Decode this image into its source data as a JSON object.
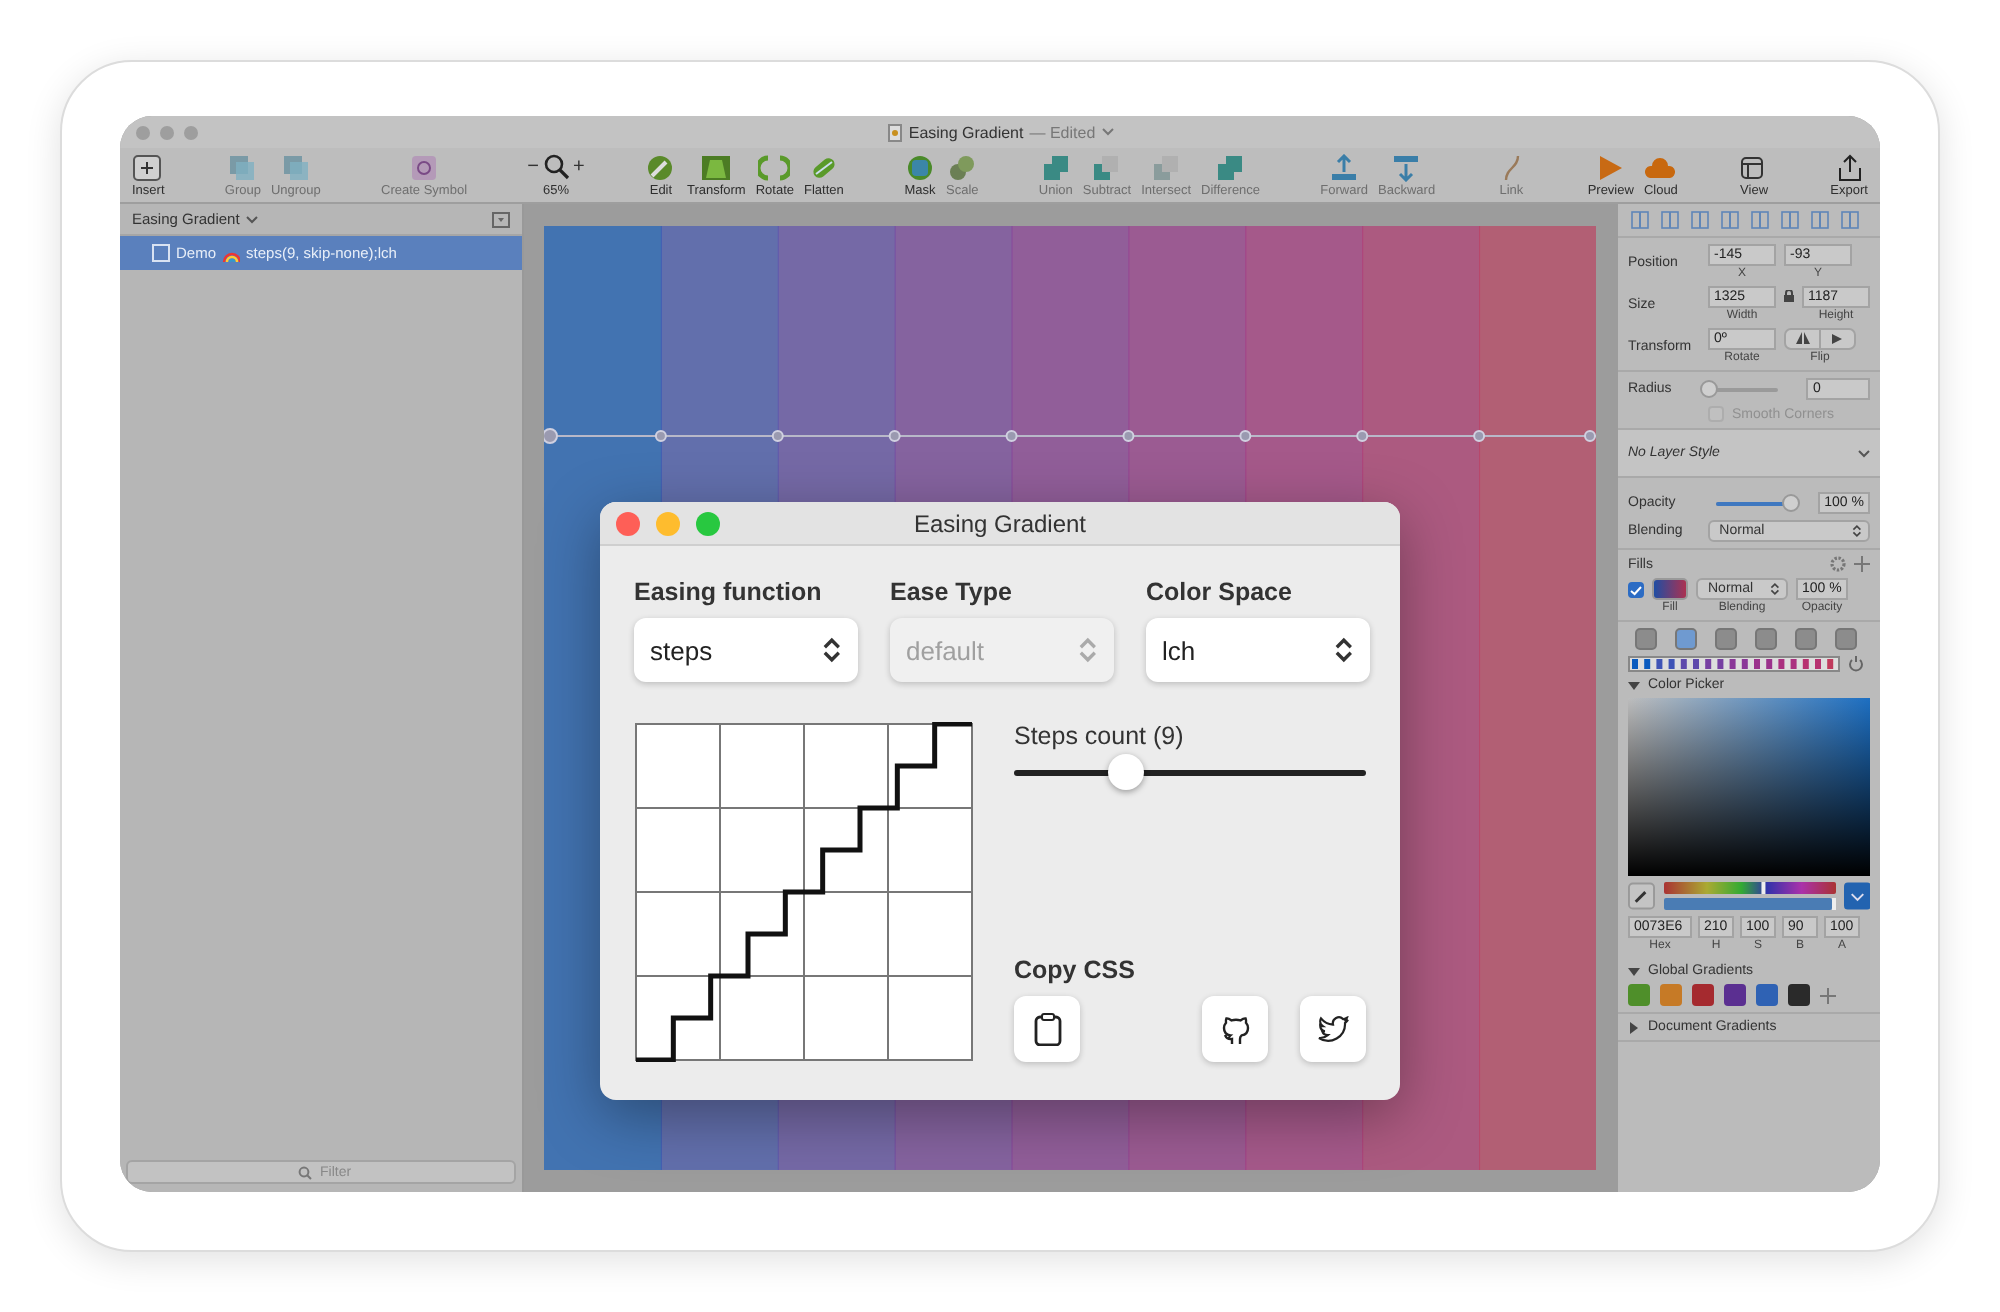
{
  "window": {
    "title": "Easing Gradient",
    "status": "— Edited"
  },
  "toolbar": {
    "groups": [
      {
        "items": [
          {
            "kind": "button",
            "label": "Insert",
            "disabled": false
          }
        ]
      },
      {
        "items": [
          {
            "kind": "button",
            "label": "Group",
            "disabled": true
          },
          {
            "kind": "button",
            "label": "Ungroup",
            "disabled": true
          }
        ]
      },
      {
        "items": [
          {
            "kind": "button",
            "label": "Create Symbol",
            "disabled": true
          }
        ]
      },
      {
        "items": [
          {
            "kind": "zoom",
            "minus": "−",
            "plus": "+",
            "label": "65%"
          }
        ]
      },
      {
        "items": [
          {
            "kind": "button",
            "label": "Edit",
            "disabled": false
          },
          {
            "kind": "button",
            "label": "Transform",
            "disabled": false
          },
          {
            "kind": "button",
            "label": "Rotate",
            "disabled": false
          },
          {
            "kind": "button",
            "label": "Flatten",
            "disabled": false
          }
        ]
      },
      {
        "items": [
          {
            "kind": "button",
            "label": "Mask",
            "disabled": false
          },
          {
            "kind": "button",
            "label": "Scale",
            "disabled": true
          }
        ]
      },
      {
        "items": [
          {
            "kind": "button",
            "label": "Union",
            "disabled": true
          },
          {
            "kind": "button",
            "label": "Subtract",
            "disabled": true
          },
          {
            "kind": "button",
            "label": "Intersect",
            "disabled": true
          },
          {
            "kind": "button",
            "label": "Difference",
            "disabled": true
          }
        ]
      },
      {
        "items": [
          {
            "kind": "button",
            "label": "Forward",
            "disabled": true
          },
          {
            "kind": "button",
            "label": "Backward",
            "disabled": true
          }
        ]
      },
      {
        "items": [
          {
            "kind": "button",
            "label": "Link",
            "disabled": true
          }
        ]
      },
      {
        "items": [
          {
            "kind": "button",
            "label": "Preview",
            "disabled": false
          },
          {
            "kind": "button",
            "label": "Cloud",
            "disabled": false
          }
        ]
      },
      {
        "items": [
          {
            "kind": "button",
            "label": "View",
            "disabled": false
          }
        ]
      },
      {
        "items": [
          {
            "kind": "button",
            "label": "Export",
            "disabled": false
          }
        ]
      }
    ]
  },
  "sidebar": {
    "page": "Easing Gradient",
    "layers": [
      {
        "name": "Demo",
        "detail": "steps(9, skip-none);lch",
        "selected": true
      }
    ],
    "filter": {
      "placeholder": "Filter"
    }
  },
  "dialog": {
    "title": "Easing Gradient",
    "selects": [
      {
        "label": "Easing function",
        "value": "steps",
        "disabled": false
      },
      {
        "label": "Ease Type",
        "value": "default",
        "disabled": true
      },
      {
        "label": "Color Space",
        "value": "lch",
        "disabled": false
      }
    ],
    "steps": {
      "label": "Steps count (9)",
      "level": 0.32
    },
    "copy": {
      "label": "Copy CSS"
    }
  },
  "inspector": {
    "position": {
      "label": "Position",
      "fields": [
        {
          "value": "-145",
          "caption": "X"
        },
        {
          "value": "-93",
          "caption": "Y"
        }
      ]
    },
    "size": {
      "label": "Size",
      "fields": [
        {
          "value": "1325",
          "caption": "Width"
        },
        {
          "value": "1187",
          "caption": "Height"
        }
      ]
    },
    "transform": {
      "label": "Transform",
      "rotate": {
        "value": "0º",
        "caption": "Rotate"
      },
      "flip_caption": "Flip"
    },
    "radius": {
      "label": "Radius",
      "level": 0,
      "value": "0"
    },
    "smooth_corners": {
      "label": "Smooth Corners",
      "checked": false,
      "disabled": true
    },
    "layer_style": "No Layer Style",
    "opacity": {
      "label": "Opacity",
      "level": 1,
      "value": "100 %"
    },
    "blending": {
      "label": "Blending",
      "value": "Normal"
    },
    "fills": {
      "title": "Fills",
      "items": [
        {
          "checked": true,
          "caption": "Fill",
          "blending": "Normal",
          "blending_caption": "Blending",
          "opacity": "100 %",
          "opacity_caption": "Opacity"
        }
      ]
    },
    "color_picker": {
      "title": "Color Picker",
      "expanded": true,
      "hue": {
        "level": 0.58
      },
      "alpha": {
        "level": 1
      },
      "hex": {
        "value": "0073E6",
        "caption": "Hex"
      },
      "components": [
        {
          "value": "210",
          "caption": "H"
        },
        {
          "value": "100",
          "caption": "S"
        },
        {
          "value": "90",
          "caption": "B"
        },
        {
          "value": "100",
          "caption": "A"
        }
      ]
    },
    "global_gradients": {
      "title": "Global Gradients",
      "expanded": true,
      "swatches": [
        {
          "color": "#4f8f2a"
        },
        {
          "color": "#c67a26"
        },
        {
          "color": "#a52a2f"
        },
        {
          "color": "#5b2f91"
        },
        {
          "color": "#2f62b4"
        },
        {
          "color": "#2a2a2a"
        }
      ]
    },
    "document_gradients": {
      "title": "Document Gradients",
      "expanded": false
    }
  }
}
